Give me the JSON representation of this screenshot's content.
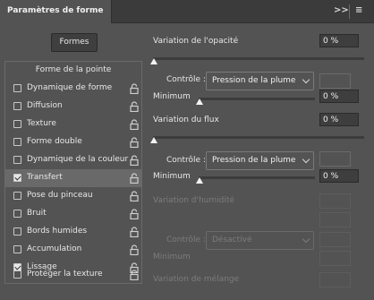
{
  "panel": {
    "tab_title": "Paramètres de forme",
    "collapse_icon": "double-chevron-right-icon",
    "menu_icon": "hamburger-menu-icon"
  },
  "presets_button": "Formes",
  "list": {
    "header": "Forme de la pointe",
    "items": [
      {
        "label": "Dynamique de forme",
        "checked": false,
        "selected": false
      },
      {
        "label": "Diffusion",
        "checked": false,
        "selected": false
      },
      {
        "label": "Texture",
        "checked": false,
        "selected": false
      },
      {
        "label": "Forme double",
        "checked": false,
        "selected": false
      },
      {
        "label": "Dynamique de la couleur",
        "checked": false,
        "selected": false
      },
      {
        "label": "Transfert",
        "checked": true,
        "selected": true
      },
      {
        "label": "Pose du pinceau",
        "checked": false,
        "selected": false
      },
      {
        "label": "Bruit",
        "checked": false,
        "selected": false
      },
      {
        "label": "Bords humides",
        "checked": false,
        "selected": false
      },
      {
        "label": "Accumulation",
        "checked": false,
        "selected": false
      },
      {
        "label": "Lissage",
        "checked": true,
        "selected": false
      },
      {
        "label": "Protéger la texture",
        "checked": false,
        "selected": false
      }
    ]
  },
  "settings": {
    "opacity_jitter": {
      "label": "Variation de l'opacité",
      "value": "0 %",
      "level": 0
    },
    "opacity_control": {
      "label": "Contrôle :",
      "value": "Pression de la plume"
    },
    "opacity_minimum": {
      "label": "Minimum",
      "value": "0 %",
      "level": 0
    },
    "flow_jitter": {
      "label": "Variation du flux",
      "value": "0 %",
      "level": 0
    },
    "flow_control": {
      "label": "Contrôle :",
      "value": "Pression de la plume"
    },
    "flow_minimum": {
      "label": "Minimum",
      "value": "0 %",
      "level": 0
    },
    "wetness_jitter": {
      "label": "Variation d'humidité"
    },
    "wetness_control": {
      "label": "Contrôle :",
      "value": "Désactivé"
    },
    "wetness_minimum": {
      "label": "Minimum"
    },
    "mix_jitter": {
      "label": "Variation de mélange"
    }
  },
  "colors": {
    "panel_bg": "#535353",
    "selected_row": "#696969",
    "disabled_text": "#7c7c7c"
  }
}
